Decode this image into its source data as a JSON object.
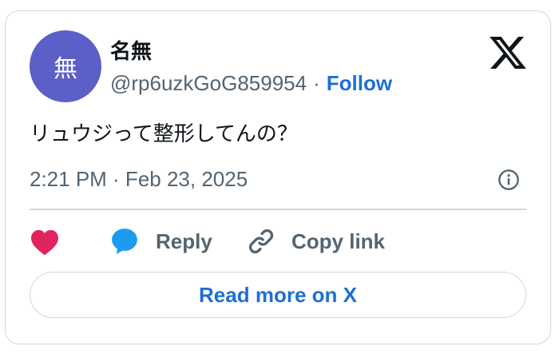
{
  "author": {
    "display_name": "名無",
    "avatar_initial": "無",
    "avatar_color": "#5b5fc7",
    "handle": "@rp6uzkGoG859954",
    "separator": "·",
    "follow_label": "Follow"
  },
  "tweet": {
    "text": "リュウジって整形してんの？",
    "timestamp": "2:21 PM · Feb 23, 2025"
  },
  "actions": {
    "like_icon": "heart-icon",
    "reply_icon": "speech-bubble-icon",
    "reply_label": "Reply",
    "copy_icon": "link-icon",
    "copy_label": "Copy link"
  },
  "footer": {
    "read_more_label": "Read more on X"
  },
  "icons": {
    "brand": "x-logo-icon",
    "info": "info-icon"
  },
  "colors": {
    "accent": "#1d6fd6",
    "like": "#e0245e",
    "reply": "#1d9bf0",
    "muted": "#536471",
    "border": "#cfd9de"
  }
}
